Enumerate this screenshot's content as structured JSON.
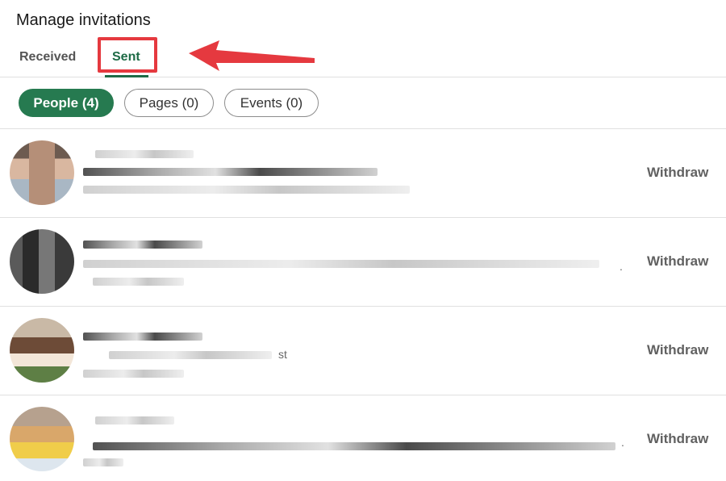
{
  "page": {
    "title": "Manage invitations"
  },
  "tabs": [
    {
      "label": "Received"
    },
    {
      "label": "Sent",
      "active": true
    }
  ],
  "filters": [
    {
      "label": "People (4)",
      "active": true
    },
    {
      "label": "Pages (0)"
    },
    {
      "label": "Events (0)"
    }
  ],
  "rows": [
    {
      "action": "Withdraw",
      "suffix": ""
    },
    {
      "action": "Withdraw",
      "suffix": "."
    },
    {
      "action": "Withdraw",
      "suffix": "st"
    },
    {
      "action": "Withdraw",
      "suffix": "."
    }
  ],
  "colors": {
    "accent": "#267a50",
    "annotation": "#e5393f"
  }
}
